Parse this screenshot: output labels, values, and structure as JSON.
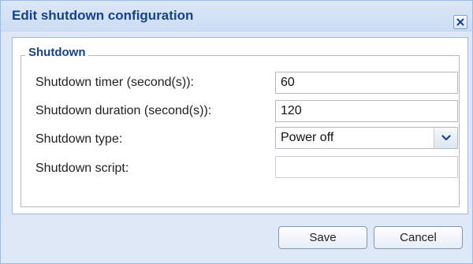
{
  "dialog": {
    "title": "Edit shutdown configuration",
    "close_icon": "close-icon"
  },
  "fieldset": {
    "legend": "Shutdown"
  },
  "fields": {
    "timer": {
      "label": "Shutdown timer (second(s)):",
      "value": "60"
    },
    "duration": {
      "label": "Shutdown duration (second(s)):",
      "value": "120"
    },
    "type": {
      "label": "Shutdown type:",
      "value": "Power off",
      "icon": "chevron-down-icon"
    },
    "script": {
      "label": "Shutdown script:",
      "value": ""
    }
  },
  "buttons": {
    "save": "Save",
    "cancel": "Cancel"
  },
  "colors": {
    "title_text": "#15428b",
    "window_bg": "#dfe8f6",
    "border": "#99bbe8"
  }
}
